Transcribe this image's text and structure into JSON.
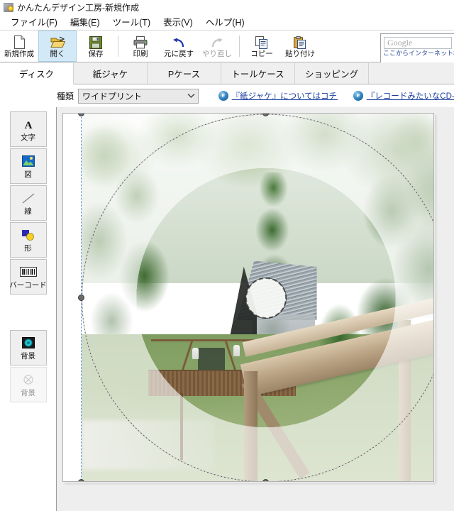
{
  "window": {
    "title": "かんたんデザイン工房-新規作成",
    "app_icon": "app-disc-icon"
  },
  "menu": {
    "items": [
      {
        "label": "ファイル(F)",
        "name": "menu-file"
      },
      {
        "label": "編集(E)",
        "name": "menu-edit"
      },
      {
        "label": "ツール(T)",
        "name": "menu-tools"
      },
      {
        "label": "表示(V)",
        "name": "menu-view"
      },
      {
        "label": "ヘルプ(H)",
        "name": "menu-help"
      }
    ]
  },
  "toolbar": {
    "buttons": [
      {
        "label": "新規作成",
        "icon": "new-document-icon",
        "state": "normal"
      },
      {
        "label": "開く",
        "icon": "open-folder-icon",
        "state": "active"
      },
      {
        "label": "保存",
        "icon": "save-floppy-icon",
        "state": "normal"
      },
      {
        "label": "印刷",
        "icon": "printer-icon",
        "state": "normal"
      },
      {
        "label": "元に戻す",
        "icon": "undo-arrow-icon",
        "state": "normal"
      },
      {
        "label": "やり直し",
        "icon": "redo-arrow-icon",
        "state": "disabled"
      },
      {
        "label": "コピー",
        "icon": "copy-icon",
        "state": "normal"
      },
      {
        "label": "貼り付け",
        "icon": "paste-clipboard-icon",
        "state": "normal"
      }
    ]
  },
  "search": {
    "placeholder": "Google",
    "value": "",
    "note": "ここからインターネット検索にご利用ください"
  },
  "tabs": [
    {
      "label": "ディスク",
      "active": true
    },
    {
      "label": "紙ジャケ",
      "active": false
    },
    {
      "label": "Pケース",
      "active": false
    },
    {
      "label": "トールケース",
      "active": false
    },
    {
      "label": "ショッピング",
      "active": false
    }
  ],
  "options": {
    "type_label": "種類",
    "type_value": "ワイドプリント",
    "type_options": [
      "ワイドプリント"
    ],
    "links": [
      {
        "label": "『紙ジャケ』についてはコチラ",
        "icon": "ie-browser-icon"
      },
      {
        "label": "『レコードみたいなCD-R",
        "icon": "ie-browser-icon"
      }
    ]
  },
  "tools": {
    "items": [
      {
        "label": "文字",
        "icon": "text-a-icon",
        "state": "normal"
      },
      {
        "label": "図",
        "icon": "picture-icon",
        "state": "normal"
      },
      {
        "label": "線",
        "icon": "line-icon",
        "state": "normal"
      },
      {
        "label": "形",
        "icon": "shape-icon",
        "state": "normal"
      },
      {
        "label": "バーコード",
        "icon": "barcode-icon",
        "state": "normal"
      }
    ],
    "background_items": [
      {
        "label": "背景",
        "icon": "background-add-icon",
        "state": "normal"
      },
      {
        "label": "背景",
        "icon": "background-remove-icon",
        "state": "disabled"
      }
    ]
  },
  "canvas": {
    "selected_object": "background-photo",
    "photo_description": "林の中のログハウスとウッドデッキの写真",
    "disc_shape": "circle",
    "hub_shape": "center-hole"
  },
  "colors": {
    "accent_tab_active": "#ffffff",
    "toolbar_active": "#d3e9f7",
    "link": "#1b3fa0",
    "canvas_background": "#eeeeee",
    "selection": "#4a7fd0"
  }
}
